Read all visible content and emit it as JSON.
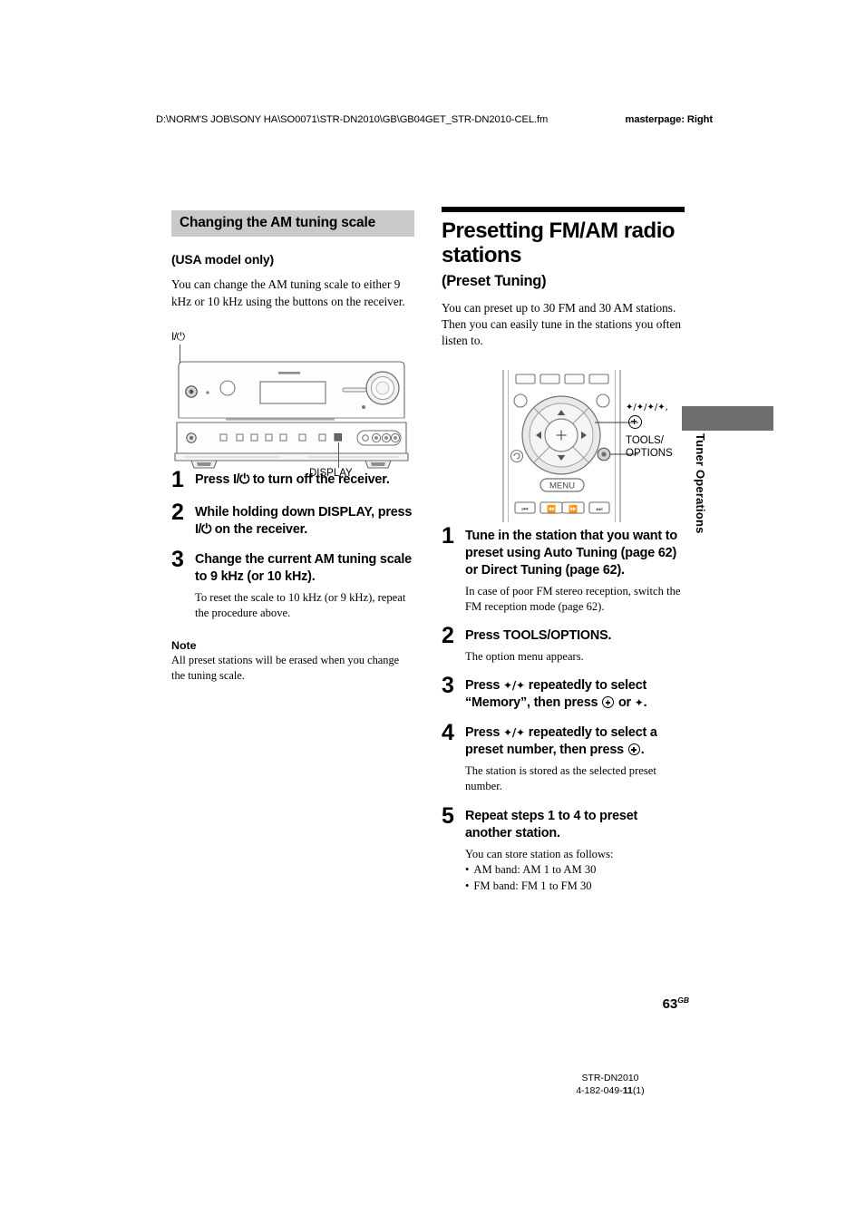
{
  "header": {
    "file_path": "D:\\NORM'S JOB\\SONY HA\\SO0071\\STR-DN2010\\GB\\GB04GET_STR-DN2010-CEL.fm",
    "masterpage": "masterpage: Right"
  },
  "left_column": {
    "section_heading": "Changing the AM tuning scale",
    "sub_heading": "(USA model only)",
    "intro": "You can change the AM tuning scale to either 9 kHz or 10 kHz using the buttons on the receiver.",
    "figure": {
      "name": "receiver-front-panel",
      "callout_power": "I/⏻",
      "callout_display": "DISPLAY"
    },
    "steps": [
      {
        "number": "1",
        "title_a": "Press ",
        "title_power": "I/⏻",
        "title_b": " to turn off the receiver.",
        "desc": ""
      },
      {
        "number": "2",
        "title_a": "While holding down DISPLAY, press ",
        "title_power": "I/⏻",
        "title_b": " on the receiver.",
        "desc": ""
      },
      {
        "number": "3",
        "title_a": "Change the current AM tuning scale to 9 kHz (or 10 kHz).",
        "title_power": "",
        "title_b": "",
        "desc": "To reset the scale to 10 kHz (or 9 kHz), repeat the procedure above."
      }
    ],
    "note_label": "Note",
    "note_text": "All preset stations will be erased when you change the tuning scale."
  },
  "right_column": {
    "title": "Presetting FM/AM radio stations",
    "subtitle": "(Preset Tuning)",
    "intro": "You can preset up to 30 FM and 30 AM stations. Then you can easily tune in the stations you often listen to.",
    "figure": {
      "name": "remote-control",
      "menu_button": "MENU",
      "callout_arrows": "✦/✦/✦/✦,",
      "callout_tools": "TOOLS/\nOPTIONS",
      "callout_tools_line1": "TOOLS/",
      "callout_tools_line2": "OPTIONS"
    },
    "steps": [
      {
        "number": "1",
        "title": "Tune in the station that you want to preset using Auto Tuning (page 62) or Direct Tuning (page 62).",
        "desc": "In case of poor FM stereo reception, switch the FM reception mode (page 62)."
      },
      {
        "number": "2",
        "title": "Press TOOLS/OPTIONS.",
        "desc": "The option menu appears."
      },
      {
        "number": "3",
        "title_part1": "Press ",
        "title_arrows": "✦/✦",
        "title_part2": " repeatedly to select “Memory”, then press ",
        "title_part3": " or ",
        "title_arrow_right": "✦",
        "title_part4": ".",
        "desc": ""
      },
      {
        "number": "4",
        "title_part1": "Press ",
        "title_arrows": "✦/✦",
        "title_part2": " repeatedly to select a preset number, then press ",
        "title_part3": ".",
        "desc": "The station is stored as the selected preset number."
      },
      {
        "number": "5",
        "title": "Repeat steps 1 to 4 to preset another station.",
        "desc": "You can store station as follows:",
        "bullets": [
          "AM band: AM 1 to AM 30",
          "FM band: FM 1 to FM 30"
        ]
      }
    ]
  },
  "side_tab": {
    "label": "Tuner Operations"
  },
  "page_number": {
    "number": "63",
    "suffix": "GB"
  },
  "footer": {
    "model": "STR-DN2010",
    "code_prefix": "4-182-049-",
    "code_bold": "11",
    "code_suffix": "(1)"
  },
  "colors": {
    "gray_heading_bar": "#c9c9c9",
    "side_tab_bar": "#6e6e6e",
    "rule_bar": "#000000"
  }
}
